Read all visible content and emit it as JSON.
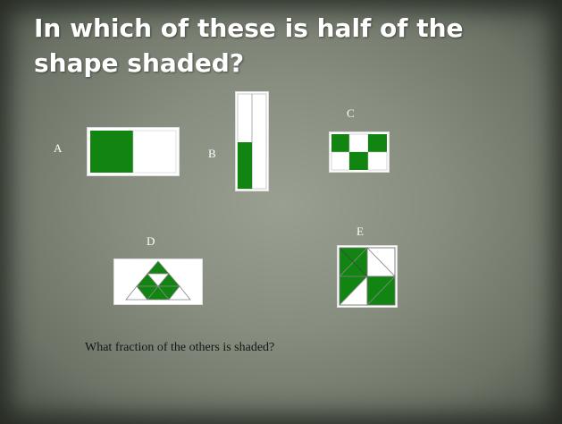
{
  "slide": {
    "title": "In which of these is half of the shape shaded?",
    "question": "What fraction of the others is shaded?",
    "labels": {
      "a": "A",
      "b": "B",
      "c": "C",
      "d": "D",
      "e": "E"
    }
  },
  "colors": {
    "shade": "#118411",
    "blank": "#ffffff",
    "title": "#ffffff"
  },
  "shapes": [
    {
      "label": "A",
      "description": "rectangle split into two halves, left half shaded"
    },
    {
      "label": "B",
      "description": "tall rectangle split into two columns and two rows, bottom-left quarter shaded"
    },
    {
      "label": "C",
      "description": "3 by 2 grid checker pattern"
    },
    {
      "label": "D",
      "description": "rectangle containing a large triangle divided into smaller triangles, some shaded"
    },
    {
      "label": "E",
      "description": "square split into four small squares each divided by a diagonal"
    }
  ]
}
